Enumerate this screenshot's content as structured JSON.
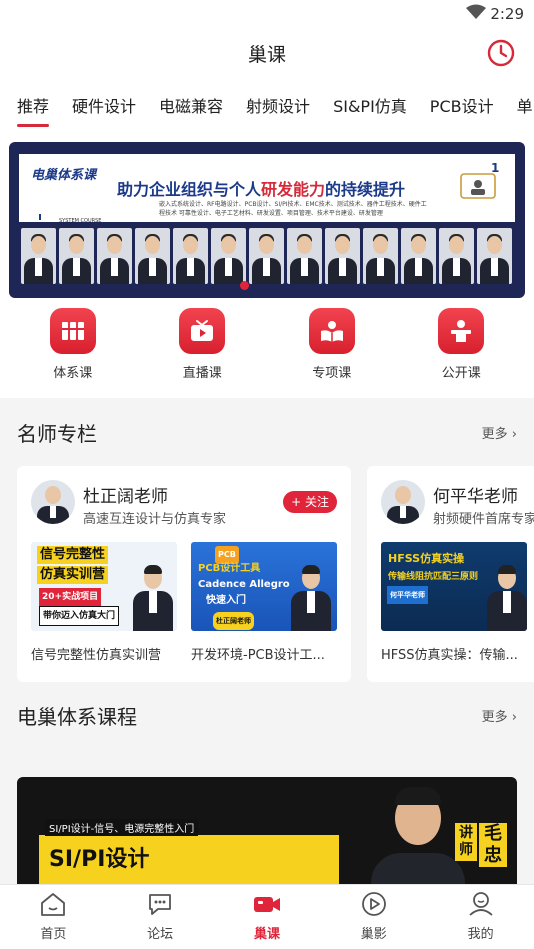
{
  "status": {
    "time": "2:29"
  },
  "header": {
    "title": "巢课"
  },
  "tabs": [
    {
      "label": "推荐"
    },
    {
      "label": "硬件设计"
    },
    {
      "label": "电磁兼容"
    },
    {
      "label": "射频设计"
    },
    {
      "label": "SI&PI仿真"
    },
    {
      "label": "PCB设计"
    },
    {
      "label": "单"
    }
  ],
  "banner": {
    "logo": "电巢体系课",
    "headline_a": "助力企业组织与个人",
    "headline_b": "研发能力",
    "headline_c": "的持续提升",
    "subline": "嵌入式系统设计、RF电路设计、PCB设计、SI/PI技术、EMC技术、测试技术、器件工程技术、硬件工程技术 可靠性设计、电子工艺材料、研发设置、项目管理、技术平台建设、研发管理",
    "sys": "SYSTEM COURSE",
    "corner_num": "1"
  },
  "quick": [
    {
      "label": "体系课",
      "icon": "books-icon"
    },
    {
      "label": "直播课",
      "icon": "tv-icon"
    },
    {
      "label": "专项课",
      "icon": "open-book-icon"
    },
    {
      "label": "公开课",
      "icon": "lectern-icon"
    }
  ],
  "famous": {
    "title": "名师专栏",
    "more": "更多",
    "cards": [
      {
        "name": "杜正阔老师",
        "desc": "高速互连设计与仿真专家",
        "follow": "+ 关注",
        "items": [
          {
            "title": "信号完整性仿真实训营",
            "thumb_a": "信号完整性",
            "thumb_b": "仿真实训营",
            "thumb_c": "20+实战项目",
            "thumb_d": "带你迈入仿真大门"
          },
          {
            "title": "开发环境-PCB设计工...",
            "thumb_a": "PCB",
            "thumb_b": "PCB设计工具",
            "thumb_c": "Cadence Allegro",
            "thumb_d": "快速入门",
            "thumb_e": "杜正阔老师"
          }
        ]
      },
      {
        "name": "何平华老师",
        "desc": "射频硬件首席专家",
        "items": [
          {
            "title": "HFSS仿真实操：传输...",
            "thumb_a": "HFSS仿真实操",
            "thumb_b": "传输线阻抗匹配三原则",
            "thumb_c": "何平华老师"
          }
        ]
      }
    ]
  },
  "system": {
    "title": "电巢体系课程",
    "more": "更多",
    "course": {
      "tag": "SI/PI设计-信号、电源完整性入门",
      "big": "SI/PI设计",
      "side_a": "讲师",
      "side_b": "毛忠"
    }
  },
  "nav": [
    {
      "label": "首页",
      "icon": "home-icon"
    },
    {
      "label": "论坛",
      "icon": "chat-icon"
    },
    {
      "label": "巢课",
      "icon": "video-camera-icon",
      "active": true
    },
    {
      "label": "巢影",
      "icon": "play-icon"
    },
    {
      "label": "我的",
      "icon": "user-icon"
    }
  ],
  "colors": {
    "accent": "#e0243a",
    "banner_bg": "#1e2656"
  }
}
